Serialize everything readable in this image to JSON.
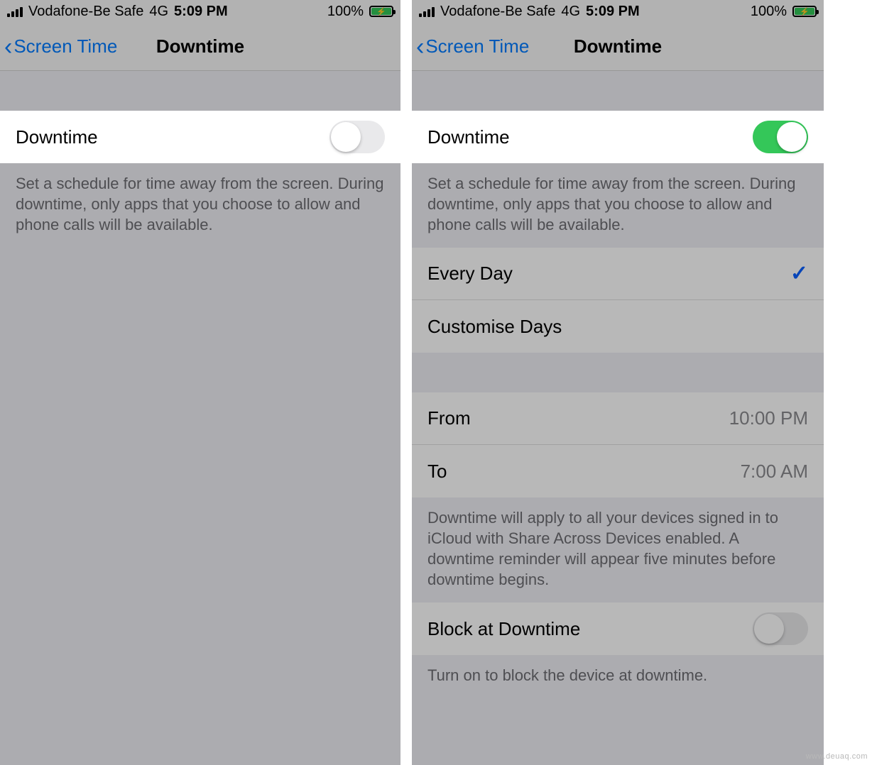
{
  "status_bar": {
    "carrier": "Vodafone-Be Safe",
    "network": "4G",
    "time": "5:09 PM",
    "battery_percent": "100%"
  },
  "nav": {
    "back_label": "Screen Time",
    "title": "Downtime"
  },
  "left_screen": {
    "downtime_label": "Downtime",
    "downtime_on": false,
    "description": "Set a schedule for time away from the screen. During downtime, only apps that you choose to allow and phone calls will be available."
  },
  "right_screen": {
    "downtime_label": "Downtime",
    "downtime_on": true,
    "description": "Set a schedule for time away from the screen. During downtime, only apps that you choose to allow and phone calls will be available.",
    "schedule_options": {
      "every_day": "Every Day",
      "every_day_selected": true,
      "customise_days": "Customise Days"
    },
    "time_range": {
      "from_label": "From",
      "from_value": "10:00 PM",
      "to_label": "To",
      "to_value": "7:00 AM"
    },
    "devices_note": "Downtime will apply to all your devices signed in to iCloud with Share Across Devices enabled. A downtime reminder will appear five minutes before downtime begins.",
    "block_label": "Block at Downtime",
    "block_on": false,
    "block_note": "Turn on to block the device at downtime."
  },
  "watermark": "www.deuaq.com"
}
